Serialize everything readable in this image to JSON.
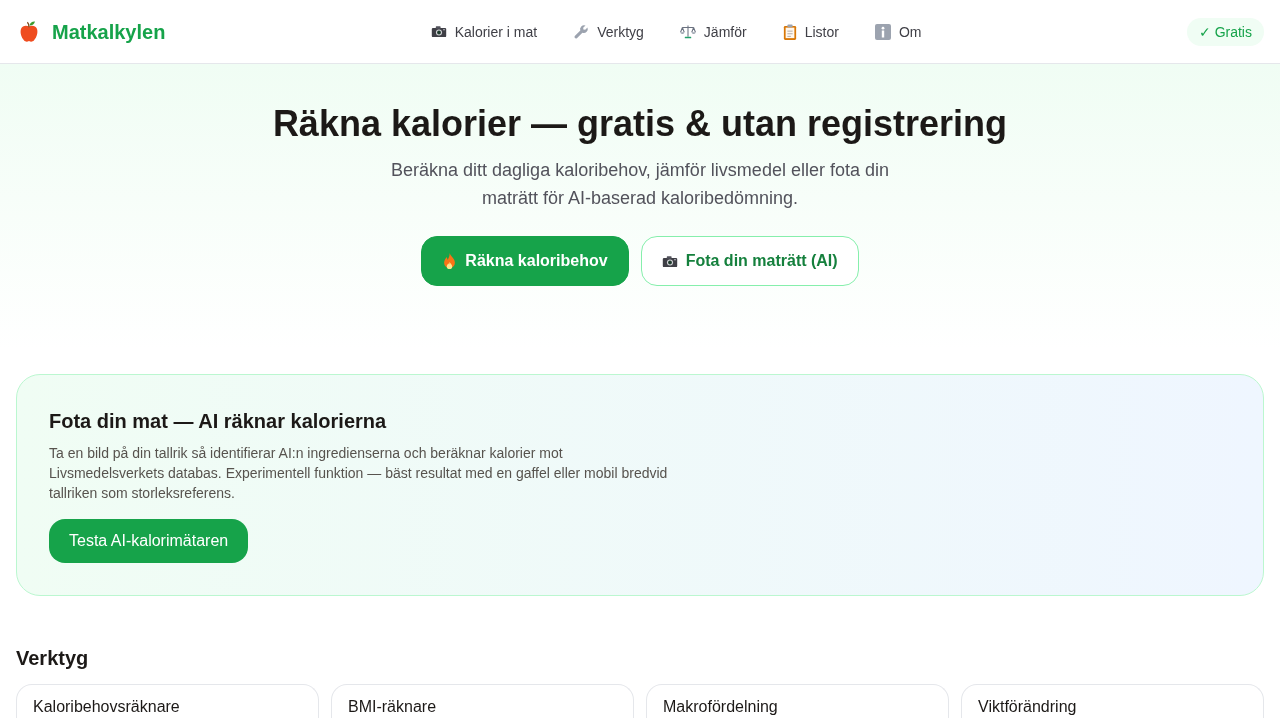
{
  "header": {
    "logo": "Matkalkylen",
    "nav": [
      {
        "label": "Kalorier i mat"
      },
      {
        "label": "Verktyg"
      },
      {
        "label": "Jämför"
      },
      {
        "label": "Listor"
      },
      {
        "label": "Om"
      }
    ],
    "badge": "✓ Gratis"
  },
  "hero": {
    "title": "Räkna kalorier — gratis & utan registrering",
    "subtitle": "Beräkna ditt dagliga kaloribehov, jämför livsmedel eller fota din maträtt för AI-baserad kaloribedömning.",
    "buttons": [
      {
        "label": "Räkna kaloribehov",
        "kind": "primary"
      },
      {
        "label": "Fota din maträtt (AI)",
        "kind": "outline"
      }
    ]
  },
  "ai_card": {
    "title": "Fota din mat — AI räknar kalorierna",
    "text": "Ta en bild på din tallrik så identifierar AI:n ingredienserna och beräknar kalorier mot Livsmedelsverkets databas. Experimentell funktion — bäst resultat med en gaffel eller mobil bredvid tallriken som storleksreferens.",
    "button": "Testa AI-kalorimätaren"
  },
  "tools": {
    "heading": "Verktyg",
    "cards": [
      {
        "title": "Kaloribehovsräknare"
      },
      {
        "title": "BMI-räknare"
      },
      {
        "title": "Makrofördelning"
      },
      {
        "title": "Viktförändring"
      }
    ]
  }
}
